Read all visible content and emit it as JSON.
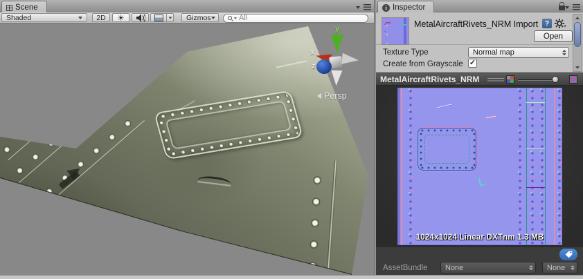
{
  "colors": {
    "accent_blue": "#3f7fd2",
    "normal_map_lavender": "#9695ee",
    "panel_bg": "#c2c2c2",
    "dark_bar": "#3c3c3c",
    "metal_green": "#6f7461",
    "sky_blue": "#a7c5e5",
    "axis_y_green": "#4faf22",
    "axis_x_red": "#b8301a",
    "axis_z_blue": "#1c3f96"
  },
  "icons": {
    "sun_glyph": "☀",
    "check_glyph": "✓",
    "help_glyph": "?",
    "info_glyph": "i"
  },
  "scene": {
    "tab_label": "Scene",
    "toolbar": {
      "shading_mode": "Shaded",
      "mode_2d": "2D",
      "gizmos_label": "Gizmos",
      "search_value": "All"
    },
    "viewport": {
      "persp_label": "Persp",
      "axis_x": "x",
      "axis_y": "y",
      "axis_z": "z"
    }
  },
  "inspector": {
    "tab_label": "Inspector",
    "header": {
      "title": "MetalAircraftRivets_NRM Import",
      "open_button": "Open"
    },
    "settings": {
      "texture_type_label": "Texture Type",
      "texture_type_value": "Normal map",
      "grayscale_label": "Create from Grayscale",
      "grayscale_checked": true
    },
    "preview": {
      "title": "MetalAircraftRivets_NRM",
      "info": "1024x1024 Linear DXTnm 1.3 MB"
    },
    "assetbundle": {
      "label": "AssetBundle",
      "bundle_value": "None",
      "variant_value": "None"
    }
  }
}
